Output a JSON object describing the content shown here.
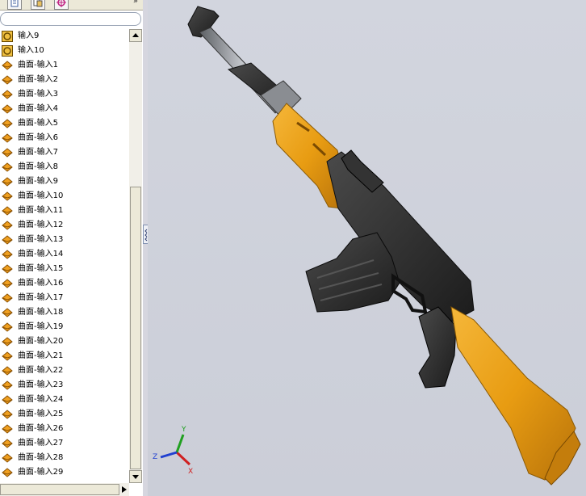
{
  "panel": {
    "tabs": [
      {
        "icon": "feature-manager-icon"
      },
      {
        "icon": "property-manager-icon"
      },
      {
        "icon": "configuration-manager-icon"
      }
    ],
    "more": "»",
    "tree_items": [
      {
        "label": "输入9",
        "icon": "imported-body-icon"
      },
      {
        "label": "输入10",
        "icon": "imported-body-icon"
      },
      {
        "label": "曲面-输入1",
        "icon": "surface-import-icon"
      },
      {
        "label": "曲面-输入2",
        "icon": "surface-import-icon"
      },
      {
        "label": "曲面-输入3",
        "icon": "surface-import-icon"
      },
      {
        "label": "曲面-输入4",
        "icon": "surface-import-icon"
      },
      {
        "label": "曲面-输入5",
        "icon": "surface-import-icon"
      },
      {
        "label": "曲面-输入6",
        "icon": "surface-import-icon"
      },
      {
        "label": "曲面-输入7",
        "icon": "surface-import-icon"
      },
      {
        "label": "曲面-输入8",
        "icon": "surface-import-icon"
      },
      {
        "label": "曲面-输入9",
        "icon": "surface-import-icon"
      },
      {
        "label": "曲面-输入10",
        "icon": "surface-import-icon"
      },
      {
        "label": "曲面-输入11",
        "icon": "surface-import-icon"
      },
      {
        "label": "曲面-输入12",
        "icon": "surface-import-icon"
      },
      {
        "label": "曲面-输入13",
        "icon": "surface-import-icon"
      },
      {
        "label": "曲面-输入14",
        "icon": "surface-import-icon"
      },
      {
        "label": "曲面-输入15",
        "icon": "surface-import-icon"
      },
      {
        "label": "曲面-输入16",
        "icon": "surface-import-icon"
      },
      {
        "label": "曲面-输入17",
        "icon": "surface-import-icon"
      },
      {
        "label": "曲面-输入18",
        "icon": "surface-import-icon"
      },
      {
        "label": "曲面-输入19",
        "icon": "surface-import-icon"
      },
      {
        "label": "曲面-输入20",
        "icon": "surface-import-icon"
      },
      {
        "label": "曲面-输入21",
        "icon": "surface-import-icon"
      },
      {
        "label": "曲面-输入22",
        "icon": "surface-import-icon"
      },
      {
        "label": "曲面-输入23",
        "icon": "surface-import-icon"
      },
      {
        "label": "曲面-输入24",
        "icon": "surface-import-icon"
      },
      {
        "label": "曲面-输入25",
        "icon": "surface-import-icon"
      },
      {
        "label": "曲面-输入26",
        "icon": "surface-import-icon"
      },
      {
        "label": "曲面-输入27",
        "icon": "surface-import-icon"
      },
      {
        "label": "曲面-输入28",
        "icon": "surface-import-icon"
      },
      {
        "label": "曲面-输入29",
        "icon": "surface-import-icon"
      }
    ]
  },
  "view": {
    "model_icon": "rifle-model",
    "triad": {
      "x": "X",
      "y": "Y",
      "z": "Z"
    },
    "colors": {
      "background": "#cfd2dc",
      "wood": "#e8a018",
      "metal": "#2a2a2a",
      "barrel": "#8a8d92"
    }
  }
}
